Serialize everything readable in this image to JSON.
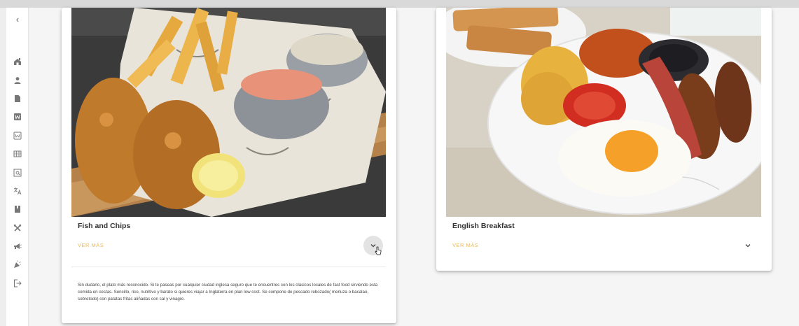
{
  "sidebar": {
    "collapse_icon": "chevron-left-icon",
    "items": [
      {
        "name": "home-icon"
      },
      {
        "name": "person-icon"
      },
      {
        "name": "document-icon"
      },
      {
        "name": "word-icon"
      },
      {
        "name": "web-icon"
      },
      {
        "name": "table-icon"
      },
      {
        "name": "search-list-icon"
      },
      {
        "name": "translate-icon"
      },
      {
        "name": "book-icon"
      },
      {
        "name": "tools-icon"
      },
      {
        "name": "megaphone-icon"
      },
      {
        "name": "party-icon"
      },
      {
        "name": "logout-icon"
      }
    ]
  },
  "cards": [
    {
      "title": "Fish and Chips",
      "more_label": "VER MÁS",
      "expand_icon": "chevron-down-icon",
      "description": "Sin dudarlo, el plato más reconocido. Si te paseas por cualquier ciudad inglesa seguro que te encuentres con los clásicos locales de fast food sirviendo esta comida en cestas. Sencillo, rico, nutritivo y barato si quieres viajar a Inglaterra en plan low cost. Se compone de pescado rebozado( merluza o bacalao, sobretodo) con patatas fritas aliñadas con sal y vinagre."
    },
    {
      "title": "English Breakfast",
      "more_label": "VER MÁS",
      "expand_icon": "chevron-down-icon"
    }
  ],
  "colors": {
    "accent": "#e8b95a",
    "title": "#333333",
    "background": "#f5f5f5"
  }
}
